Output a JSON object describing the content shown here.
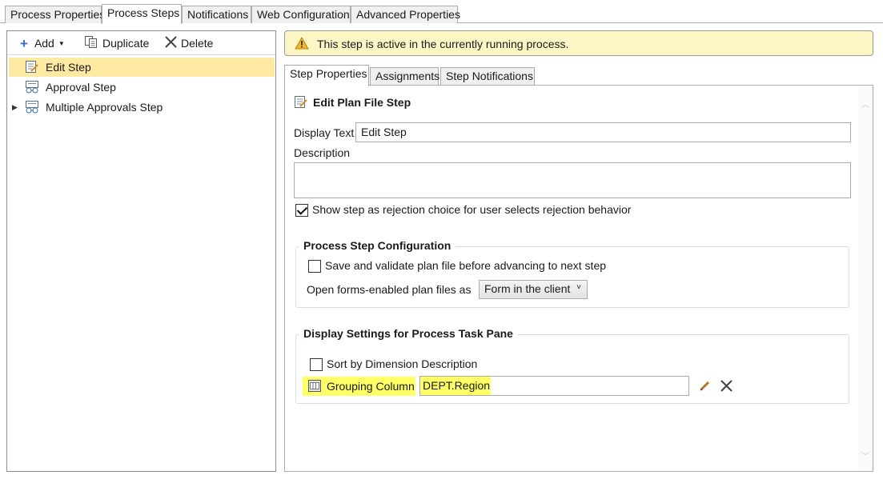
{
  "top_tabs": [
    "Process Properties",
    "Process Steps",
    "Notifications",
    "Web Configuration",
    "Advanced Properties"
  ],
  "toolbar": {
    "add_label": "Add",
    "duplicate_label": "Duplicate",
    "delete_label": "Delete"
  },
  "tree": {
    "items": [
      {
        "label": "Edit Step",
        "selected": true
      },
      {
        "label": "Approval Step"
      },
      {
        "label": "Multiple Approvals Step",
        "expandable": true
      }
    ]
  },
  "banner": {
    "text": "This step is active in the currently running process."
  },
  "inner_tabs": [
    "Step Properties",
    "Assignments",
    "Step Notifications"
  ],
  "props": {
    "header": "Edit Plan File Step",
    "display_text_label": "Display Text",
    "display_text_value": "Edit Step",
    "description_label": "Description",
    "description_value": "",
    "rejection_checkbox_label": "Show step as rejection choice for user selects rejection behavior",
    "rejection_checked": true
  },
  "process_config": {
    "title": "Process Step Configuration",
    "save_validate_label": "Save and validate plan file before advancing to next step",
    "open_forms_label": "Open forms-enabled plan files as",
    "open_forms_value": "Form in the client"
  },
  "display_settings": {
    "title": "Display Settings for Process Task Pane",
    "sort_label": "Sort by Dimension Description",
    "grouping_label": "Grouping Column",
    "grouping_value": "DEPT.Region"
  },
  "colors": {
    "selection": "#fde9a1",
    "highlight": "#ffff66",
    "banner_bg": "#fcf6c5",
    "accent_blue": "#2e6fd6"
  }
}
